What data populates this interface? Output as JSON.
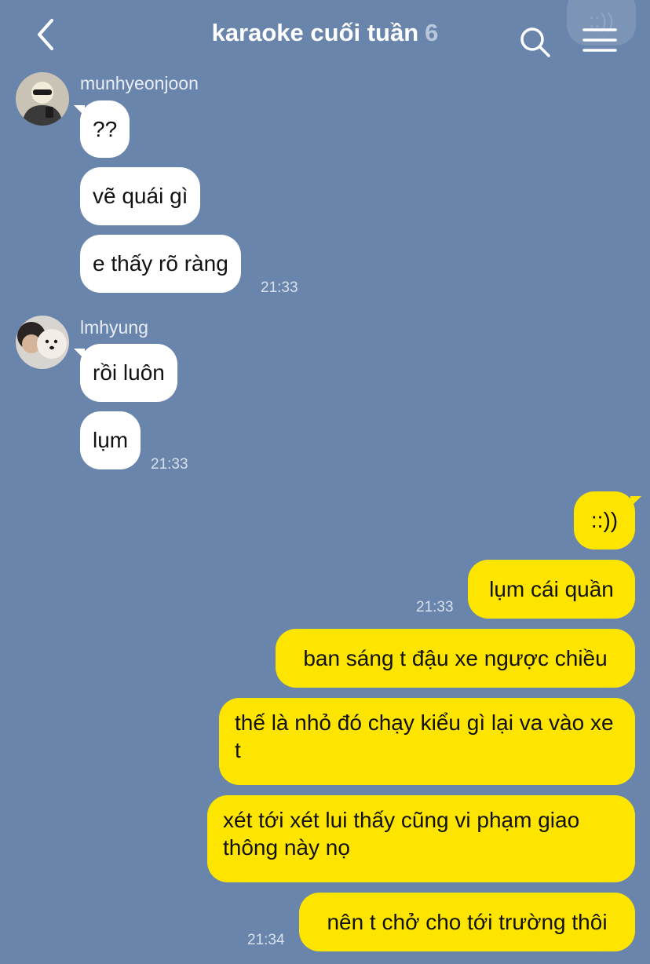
{
  "header": {
    "title": "karaoke cuối tuần",
    "member_count": "6",
    "ghost_preview": "::))"
  },
  "groups": [
    {
      "sender": "munhyeonjoon",
      "messages": [
        "??",
        "vẽ quái gì",
        "e thấy rõ ràng"
      ],
      "time": "21:33"
    },
    {
      "sender": "lmhyung",
      "messages": [
        "rồi luôn",
        "lụm"
      ],
      "time": "21:33"
    }
  ],
  "outgoing": {
    "messages": [
      "::))",
      "lụm cái quần",
      "ban sáng t đậu xe ngược chiều",
      "thế là nhỏ đó chạy kiểu gì lại va vào xe t",
      "xét tới xét lui thấy cũng vi phạm giao thông này nọ",
      "nên t chở cho tới trường thôi"
    ],
    "time_1": "21:33",
    "time_2": "21:34"
  },
  "colors": {
    "background": "#6a85ac",
    "incoming_bubble": "#ffffff",
    "outgoing_bubble": "#fee500"
  },
  "icons": {
    "back": "chevron-left-icon",
    "search": "search-icon",
    "menu": "hamburger-menu-icon"
  }
}
